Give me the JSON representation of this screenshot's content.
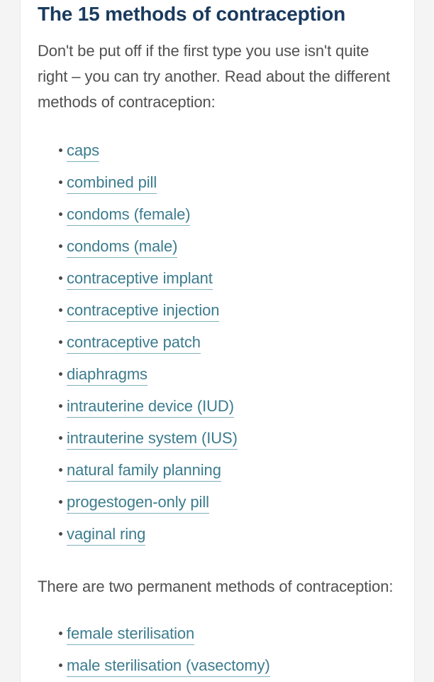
{
  "page": {
    "background_color": "#f4f4f4",
    "card_background_color": "#ffffff",
    "card_border_color": "#e8e8e8"
  },
  "article": {
    "title": "The 15 methods of contraception",
    "title_color": "#1a3a5e",
    "body_text_color": "#505050",
    "link_color": "#3c7c8e",
    "link_underline_color": "#7fb0bd",
    "bullet_color": "#4a4a4a",
    "intro_paragraph": "Don't be put off if the first type you use isn't quite right – you can try another. Read about the different methods of contraception:",
    "methods": [
      {
        "label": "caps"
      },
      {
        "label": "combined pill"
      },
      {
        "label": "condoms (female)"
      },
      {
        "label": "condoms (male)"
      },
      {
        "label": "contraceptive implant"
      },
      {
        "label": "contraceptive injection"
      },
      {
        "label": "contraceptive patch"
      },
      {
        "label": "diaphragms"
      },
      {
        "label": "intrauterine device (IUD)"
      },
      {
        "label": "intrauterine system (IUS)"
      },
      {
        "label": "natural family planning"
      },
      {
        "label": "progestogen-only pill"
      },
      {
        "label": "vaginal ring"
      }
    ],
    "permanent_paragraph": "There are two permanent methods of contraception:",
    "permanent_methods": [
      {
        "label": "female sterilisation"
      },
      {
        "label": "male sterilisation (vasectomy)"
      }
    ]
  }
}
